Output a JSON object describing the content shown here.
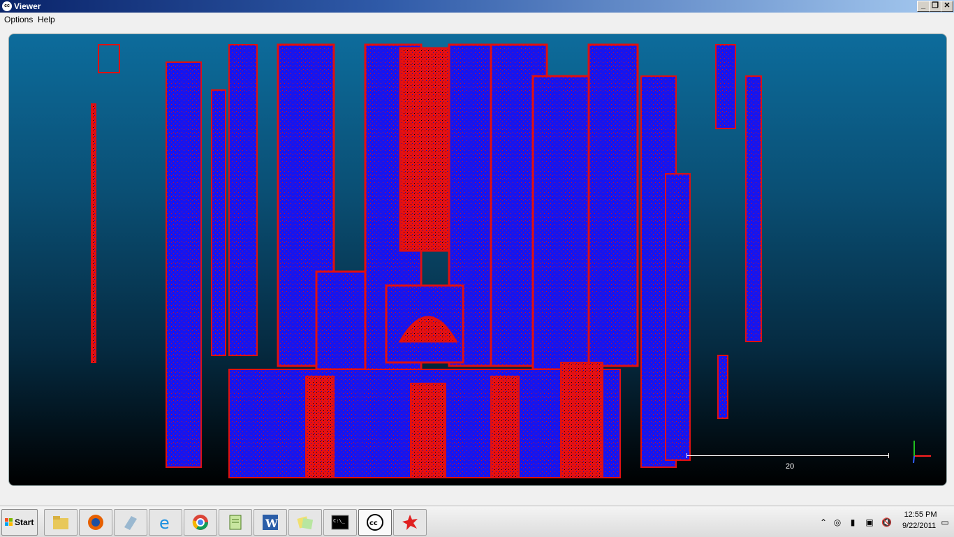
{
  "window": {
    "title": "Viewer",
    "app_icon_text": "cc",
    "controls": {
      "minimize": "_",
      "restore": "❐",
      "close": "✕"
    }
  },
  "menu": {
    "items": [
      "Options",
      "Help"
    ]
  },
  "viewer": {
    "scene_description_icon": "point-cloud-cathedral-facade",
    "colors": {
      "background_top": "#0d6c9c",
      "background_bottom": "#000000",
      "point_red": "#ff1a1a",
      "point_blue": "#1a1aff"
    },
    "scale_label": "20",
    "axis_colors": {
      "x": "#ff2020",
      "y": "#20c020",
      "z": "#3060ff"
    }
  },
  "taskbar": {
    "start_label": "Start",
    "apps": [
      {
        "name": "windows-explorer",
        "icon": "folder-icon"
      },
      {
        "name": "firefox",
        "icon": "firefox-icon"
      },
      {
        "name": "app-3",
        "icon": "eraser-icon"
      },
      {
        "name": "internet-explorer",
        "icon": "ie-icon"
      },
      {
        "name": "chrome",
        "icon": "chrome-icon"
      },
      {
        "name": "notepadplusplus",
        "icon": "notepad-icon"
      },
      {
        "name": "word",
        "icon": "word-icon"
      },
      {
        "name": "app-8",
        "icon": "sticky-notes-icon"
      },
      {
        "name": "command-prompt",
        "icon": "cmd-icon"
      },
      {
        "name": "cloudcompare",
        "icon": "cc-icon"
      },
      {
        "name": "app-11",
        "icon": "red-splat-icon"
      }
    ],
    "clock_time": "12:55 PM",
    "clock_date": "9/22/2011"
  }
}
